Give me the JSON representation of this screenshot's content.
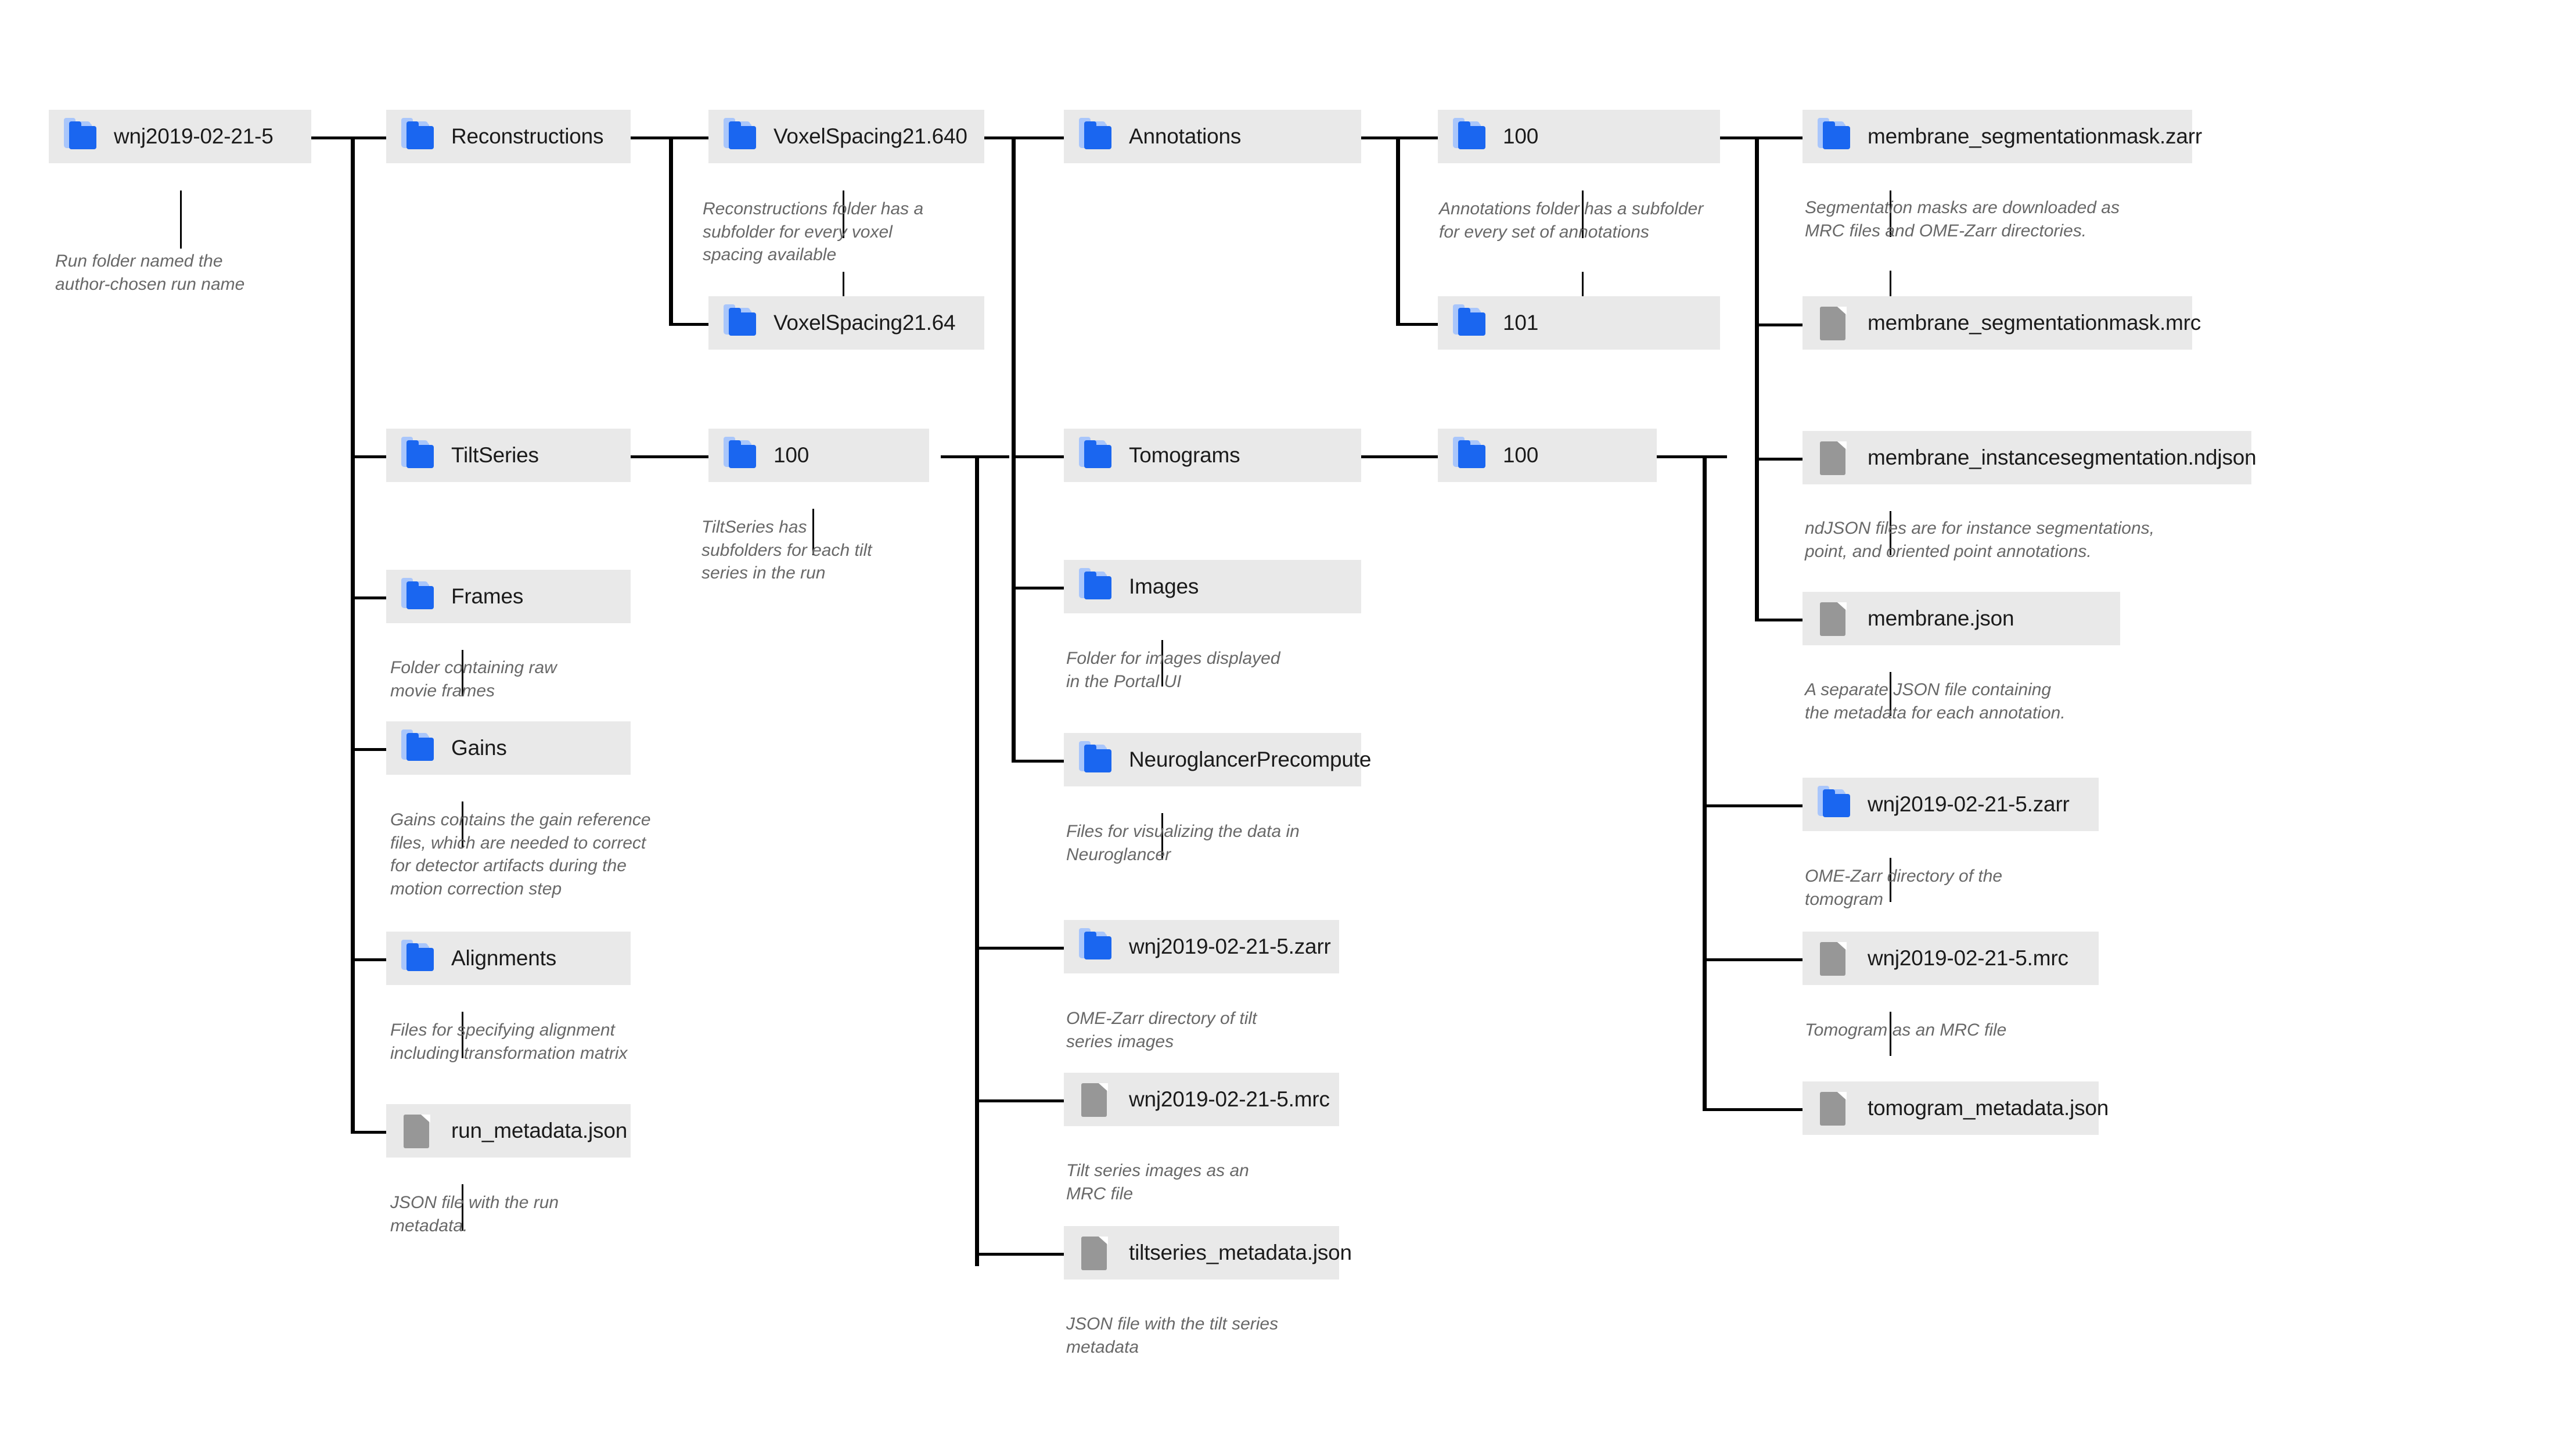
{
  "diagram": {
    "title": "CryoET Data Portal run folder structure",
    "colors": {
      "node_background": "#e9e9e9",
      "folder_icon": "#1a66f0",
      "folder_icon_back": "#a9c6fb",
      "file_icon": "#979797",
      "line": "#000000",
      "caption_text": "#686868",
      "label_text": "#1b1b1b"
    }
  },
  "nodes": {
    "run_root": {
      "label": "wnj2019-02-21-5",
      "icon": "folder-icon"
    },
    "reconstructions": {
      "label": "Reconstructions",
      "icon": "folder-icon"
    },
    "voxelspacing_640": {
      "label": "VoxelSpacing21.640",
      "icon": "folder-icon"
    },
    "voxelspacing_64": {
      "label": "VoxelSpacing21.64",
      "icon": "folder-icon"
    },
    "annotations": {
      "label": "Annotations",
      "icon": "folder-icon"
    },
    "ann_100": {
      "label": "100",
      "icon": "folder-icon"
    },
    "ann_101": {
      "label": "101",
      "icon": "folder-icon"
    },
    "seg_mask_zarr": {
      "label": "membrane_segmentationmask.zarr",
      "icon": "folder-icon"
    },
    "seg_mask_mrc": {
      "label": "membrane_segmentationmask.mrc",
      "icon": "file-icon"
    },
    "inst_seg_ndjson": {
      "label": "membrane_instancesegmentation.ndjson",
      "icon": "file-icon"
    },
    "membrane_json": {
      "label": "membrane.json",
      "icon": "file-icon"
    },
    "tiltseries": {
      "label": "TiltSeries",
      "icon": "folder-icon"
    },
    "tiltseries_100": {
      "label": "100",
      "icon": "folder-icon"
    },
    "frames": {
      "label": "Frames",
      "icon": "folder-icon"
    },
    "gains": {
      "label": "Gains",
      "icon": "folder-icon"
    },
    "alignments": {
      "label": "Alignments",
      "icon": "folder-icon"
    },
    "run_metadata_json": {
      "label": "run_metadata.json",
      "icon": "file-icon"
    },
    "tomograms": {
      "label": "Tomograms",
      "icon": "folder-icon"
    },
    "tomo_100": {
      "label": "100",
      "icon": "folder-icon"
    },
    "images": {
      "label": "Images",
      "icon": "folder-icon"
    },
    "neuroglancer": {
      "label": "NeuroglancerPrecompute",
      "icon": "folder-icon"
    },
    "ts_zarr": {
      "label": "wnj2019-02-21-5.zarr",
      "icon": "folder-icon"
    },
    "ts_mrc": {
      "label": "wnj2019-02-21-5.mrc",
      "icon": "file-icon"
    },
    "ts_metadata_json": {
      "label": "tiltseries_metadata.json",
      "icon": "file-icon"
    },
    "tomo_zarr": {
      "label": "wnj2019-02-21-5.zarr",
      "icon": "folder-icon"
    },
    "tomo_mrc": {
      "label": "wnj2019-02-21-5.mrc",
      "icon": "file-icon"
    },
    "tomo_metadata_json": {
      "label": "tomogram_metadata.json",
      "icon": "file-icon"
    }
  },
  "captions": {
    "run_root": "Run folder named the\nauthor-chosen run name",
    "reconstructions": "Reconstructions folder has a\nsubfolder for every voxel\nspacing available",
    "annotations": "Annotations folder has a subfolder\nfor every set of annotations",
    "seg_mask": "Segmentation masks are downloaded as\nMRC files and OME-Zarr directories.",
    "inst_seg": "ndJSON files are for instance segmentations,\npoint, and oriented point annotations.",
    "membrane_json": "A separate JSON file containing\nthe metadata for each annotation.",
    "tiltseries_100": "TiltSeries has\nsubfolders for each tilt\nseries in the run",
    "frames": "Folder containing raw\nmovie frames",
    "gains": "Gains contains the gain reference\nfiles, which are needed to correct\nfor detector artifacts during the\nmotion correction step",
    "alignments": "Files for specifying alignment\nincluding transformation matrix",
    "run_metadata": "JSON file with the run\nmetadata.",
    "images": "Folder for images displayed\nin the Portal UI",
    "neuroglancer": "Files for visualizing the data in\nNeuroglancer",
    "ts_zarr": "OME-Zarr directory of tilt\nseries images",
    "ts_mrc": "Tilt series images as an\nMRC file",
    "ts_metadata": "JSON file with the tilt series\nmetadata",
    "tomo_zarr": "OME-Zarr directory of the\ntomogram",
    "tomo_mrc": "Tomogram as an MRC file"
  }
}
